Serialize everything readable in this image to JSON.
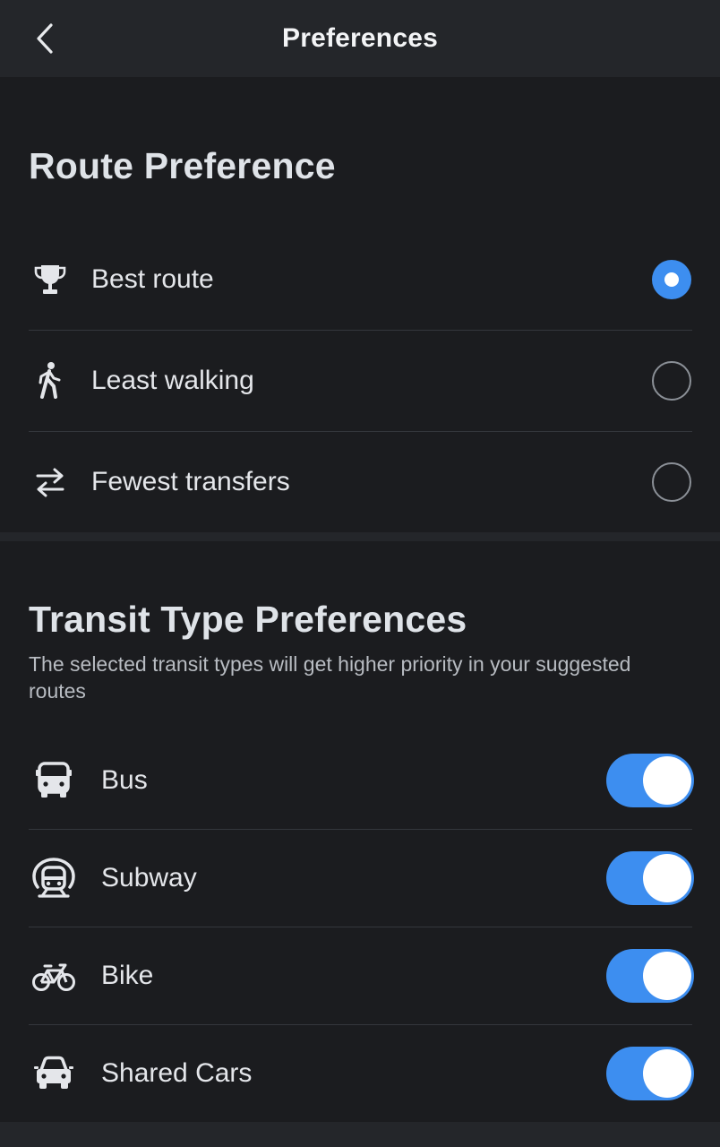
{
  "header": {
    "title": "Preferences",
    "back_icon": "chevron-left-icon"
  },
  "route_preference": {
    "title": "Route Preference",
    "options": [
      {
        "label": "Best route",
        "icon": "trophy-icon",
        "selected": true
      },
      {
        "label": "Least walking",
        "icon": "walking-person-icon",
        "selected": false
      },
      {
        "label": "Fewest transfers",
        "icon": "transfer-arrows-icon",
        "selected": false
      }
    ]
  },
  "transit_types": {
    "title": "Transit Type Preferences",
    "description": "The selected transit types will get higher priority in your suggested routes",
    "items": [
      {
        "label": "Bus",
        "icon": "bus-icon",
        "enabled": true
      },
      {
        "label": "Subway",
        "icon": "subway-icon",
        "enabled": true
      },
      {
        "label": "Bike",
        "icon": "bike-icon",
        "enabled": true
      },
      {
        "label": "Shared Cars",
        "icon": "car-icon",
        "enabled": true
      }
    ]
  },
  "colors": {
    "accent": "#3d8ef0",
    "background": "#1b1c1f",
    "header_background": "#24262a"
  }
}
